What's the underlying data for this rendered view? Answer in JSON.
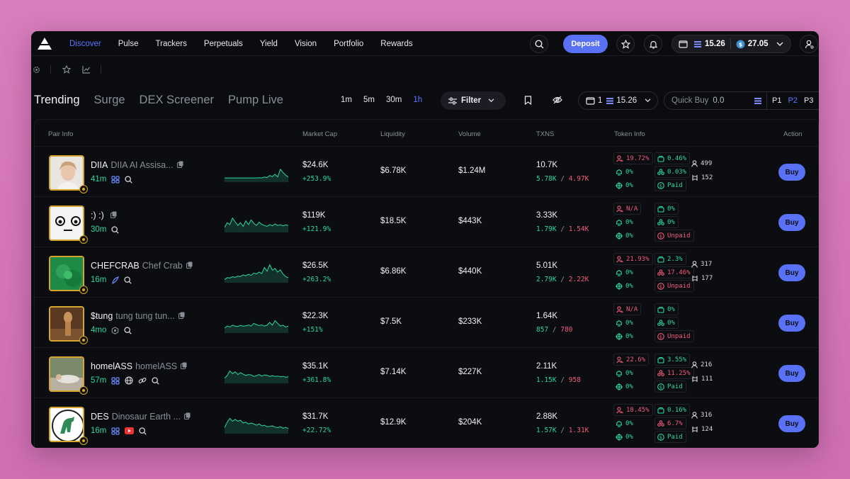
{
  "nav": {
    "links": [
      "Discover",
      "Pulse",
      "Trackers",
      "Perpetuals",
      "Yield",
      "Vision",
      "Portfolio",
      "Rewards"
    ],
    "active": "Discover",
    "deposit_label": "Deposit",
    "wallet": {
      "sol_balance": "15.26",
      "usd_balance": "27.05"
    }
  },
  "tabs": {
    "items": [
      "Trending",
      "Surge",
      "DEX Screener",
      "Pump Live"
    ],
    "active": "Trending"
  },
  "timeframes": {
    "items": [
      "1m",
      "5m",
      "30m",
      "1h"
    ],
    "active": "1h"
  },
  "filter_label": "Filter",
  "wallet_select": {
    "count": "1",
    "balance": "15.26"
  },
  "quick_buy": {
    "label": "Quick Buy",
    "value": "0.0"
  },
  "presets": {
    "items": [
      "P1",
      "P2",
      "P3"
    ],
    "active": "P2"
  },
  "table": {
    "headers": {
      "pair_info": "Pair Info",
      "market_cap": "Market Cap",
      "liquidity": "Liquidity",
      "volume": "Volume",
      "txns": "TXNS",
      "token_info": "Token Info",
      "action": "Action"
    },
    "buy_label": "Buy",
    "rows": [
      {
        "ticker": "DIIA",
        "name": "DIIA AI Assisa...",
        "age": "41m",
        "market_cap": "$24.6K",
        "mc_change": "+253.9%",
        "liquidity": "$6.78K",
        "volume": "$1.24M",
        "txns": "10.7K",
        "buys": "5.78K",
        "sells": "4.97K",
        "top10": "19.72%",
        "dev": "0.46%",
        "snipers": "0%",
        "insiders": "0.03%",
        "bundle": "0%",
        "dex": "Paid",
        "holders": "499",
        "pro": "152"
      },
      {
        "ticker": ":) :)",
        "name": "",
        "age": "30m",
        "market_cap": "$119K",
        "mc_change": "+121.9%",
        "liquidity": "$18.5K",
        "volume": "$443K",
        "txns": "3.33K",
        "buys": "1.79K",
        "sells": "1.54K",
        "top10": "N/A",
        "dev": "0%",
        "snipers": "0%",
        "insiders": "0%",
        "bundle": "0%",
        "dex": "Unpaid",
        "holders": "",
        "pro": ""
      },
      {
        "ticker": "CHEFCRAB",
        "name": "Chef Crab",
        "age": "16m",
        "market_cap": "$26.5K",
        "mc_change": "+263.2%",
        "liquidity": "$6.86K",
        "volume": "$440K",
        "txns": "5.01K",
        "buys": "2.79K",
        "sells": "2.22K",
        "top10": "21.93%",
        "dev": "2.3%",
        "snipers": "0%",
        "insiders": "17.46%",
        "bundle": "0%",
        "dex": "Unpaid",
        "holders": "317",
        "pro": "177"
      },
      {
        "ticker": "$tung",
        "name": "tung tung tun...",
        "age": "4mo",
        "market_cap": "$22.3K",
        "mc_change": "+151%",
        "liquidity": "$7.5K",
        "volume": "$233K",
        "txns": "1.64K",
        "buys": "857",
        "sells": "780",
        "top10": "N/A",
        "dev": "0%",
        "snipers": "0%",
        "insiders": "0%",
        "bundle": "0%",
        "dex": "Unpaid",
        "holders": "",
        "pro": ""
      },
      {
        "ticker": "homelASS",
        "name": "homelASS",
        "age": "57m",
        "market_cap": "$35.1K",
        "mc_change": "+361.8%",
        "liquidity": "$7.14K",
        "volume": "$227K",
        "txns": "2.11K",
        "buys": "1.15K",
        "sells": "958",
        "top10": "22.6%",
        "dev": "3.55%",
        "snipers": "0%",
        "insiders": "11.25%",
        "bundle": "0%",
        "dex": "Paid",
        "holders": "216",
        "pro": "111"
      },
      {
        "ticker": "DES",
        "name": "Dinosaur Earth ...",
        "age": "16m",
        "market_cap": "$31.7K",
        "mc_change": "+22.72%",
        "liquidity": "$12.9K",
        "volume": "$204K",
        "txns": "2.88K",
        "buys": "1.57K",
        "sells": "1.31K",
        "top10": "18.45%",
        "dev": "0.16%",
        "snipers": "0%",
        "insiders": "6.7%",
        "bundle": "0%",
        "dex": "Paid",
        "holders": "316",
        "pro": "124"
      }
    ]
  },
  "colors": {
    "accent": "#5871f5",
    "positive": "#2ed7a0",
    "negative": "#f25c7a",
    "avatar_border": "#d4a72c"
  }
}
